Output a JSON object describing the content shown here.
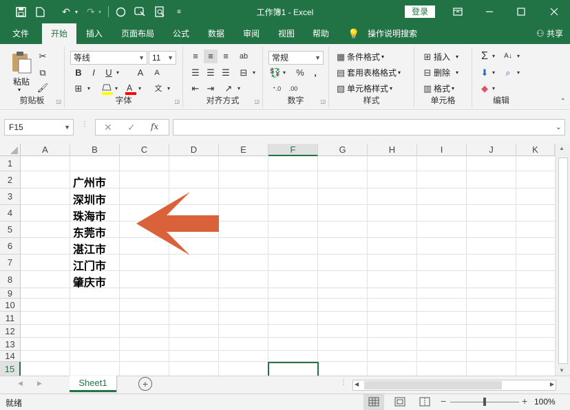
{
  "titlebar": {
    "title": "工作簿1  -  Excel",
    "login_label": "登录",
    "icons": [
      "save-icon",
      "new-doc-icon",
      "undo-icon",
      "redo-icon",
      "circle-shape-icon",
      "screenshot-icon",
      "print-preview-icon",
      "customize-icon"
    ]
  },
  "tabs": {
    "items": [
      "文件",
      "开始",
      "插入",
      "页面布局",
      "公式",
      "数据",
      "审阅",
      "视图",
      "帮助"
    ],
    "active": "开始",
    "tell_me": "操作说明搜索",
    "share": "共享"
  },
  "ribbon": {
    "clipboard": {
      "paste": "粘贴",
      "label": "剪贴板"
    },
    "font": {
      "name": "等线",
      "size": "11",
      "bold": "B",
      "italic": "I",
      "underline": "U",
      "grow": "A",
      "shrink": "A",
      "label": "字体",
      "fill_color": "#ffff00",
      "font_color": "#ff0000"
    },
    "alignment": {
      "label": "对齐方式"
    },
    "number": {
      "format": "常规",
      "percent": "%",
      "comma": ",",
      "label": "数字"
    },
    "styles": {
      "conditional": "条件格式",
      "table": "套用表格格式",
      "cell_styles": "单元格样式",
      "label": "样式"
    },
    "cells": {
      "insert": "插入",
      "delete": "删除",
      "format": "格式",
      "label": "单元格"
    },
    "editing": {
      "label": "编辑"
    }
  },
  "formula_bar": {
    "name_box": "F15",
    "fx": "fx",
    "value": ""
  },
  "grid": {
    "columns": [
      "A",
      "B",
      "C",
      "D",
      "E",
      "F",
      "G",
      "H",
      "I",
      "J",
      "K"
    ],
    "selected_column": "F",
    "rows": [
      "1",
      "2",
      "3",
      "4",
      "5",
      "6",
      "7",
      "8",
      "9",
      "10",
      "11",
      "12",
      "13",
      "14",
      "15"
    ],
    "selected_row": "15",
    "column_b_values": [
      "广州市",
      "深圳市",
      "珠海市",
      "东莞市",
      "湛江市",
      "江门市",
      "肇庆市"
    ],
    "arrow_color": "#d9623b"
  },
  "sheets": {
    "tabs": [
      "Sheet1"
    ],
    "active": "Sheet1"
  },
  "status": {
    "ready": "就绪",
    "zoom": "100%"
  },
  "colors": {
    "brand": "#217346",
    "ribbon_bg": "#f3f3f3"
  }
}
